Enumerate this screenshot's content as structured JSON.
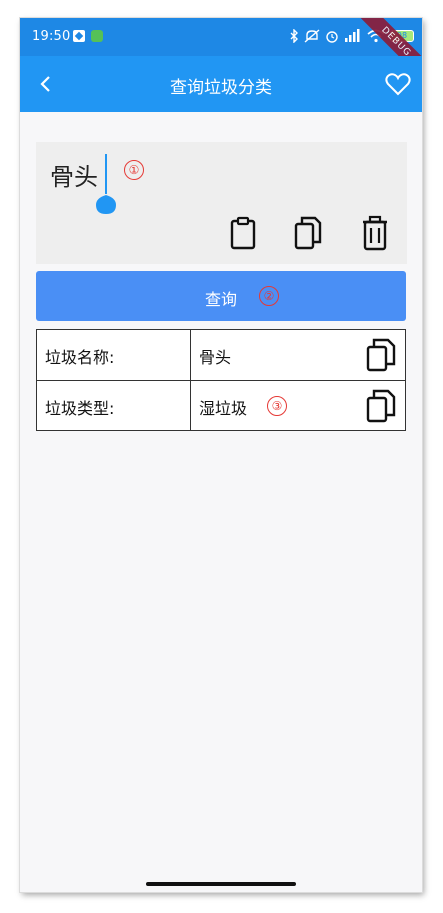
{
  "status_bar": {
    "time": "19:50",
    "battery": "98",
    "debug_ribbon": "DEBUG"
  },
  "app_bar": {
    "title": "查询垃圾分类",
    "back_icon": "chevron-left-icon",
    "favorite_icon": "heart-outline-icon"
  },
  "input": {
    "value": "骨头",
    "marker": "①",
    "tools": [
      "paste-icon",
      "copy-icon",
      "delete-icon"
    ]
  },
  "query_button": {
    "label": "查询",
    "marker": "②"
  },
  "result_table": {
    "rows": [
      {
        "label": "垃圾名称:",
        "value": "骨头",
        "marker": ""
      },
      {
        "label": "垃圾类型:",
        "value": "湿垃圾",
        "marker": "③"
      }
    ]
  },
  "colors": {
    "status_bar": "#1e88e5",
    "app_bar": "#2196f3",
    "button": "#4a8ff5",
    "marker": "#e53935"
  }
}
